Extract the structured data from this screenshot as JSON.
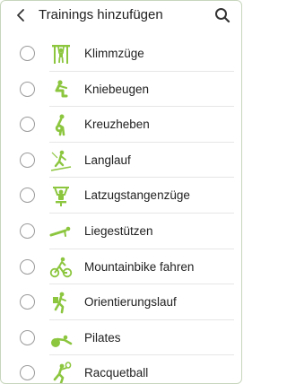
{
  "header": {
    "title": "Trainings hinzufügen",
    "back_icon": "back-arrow-icon",
    "search_icon": "search-icon"
  },
  "colors": {
    "accent_green": "#8cc63f",
    "radio_border": "#9a9a9a",
    "text": "#1f1f1f"
  },
  "workouts": [
    {
      "label": "Klimmzüge",
      "icon": "pull-up-icon",
      "selected": false
    },
    {
      "label": "Kniebeugen",
      "icon": "squat-icon",
      "selected": false
    },
    {
      "label": "Kreuzheben",
      "icon": "deadlift-icon",
      "selected": false
    },
    {
      "label": "Langlauf",
      "icon": "cross-country-ski-icon",
      "selected": false
    },
    {
      "label": "Latzugstangenzüge",
      "icon": "lat-pulldown-icon",
      "selected": false
    },
    {
      "label": "Liegestützen",
      "icon": "push-up-icon",
      "selected": false
    },
    {
      "label": "Mountainbike fahren",
      "icon": "mountain-bike-icon",
      "selected": false
    },
    {
      "label": "Orientierungslauf",
      "icon": "orienteering-icon",
      "selected": false
    },
    {
      "label": "Pilates",
      "icon": "pilates-icon",
      "selected": false
    },
    {
      "label": "Racquetball",
      "icon": "racquetball-icon",
      "selected": false
    }
  ]
}
